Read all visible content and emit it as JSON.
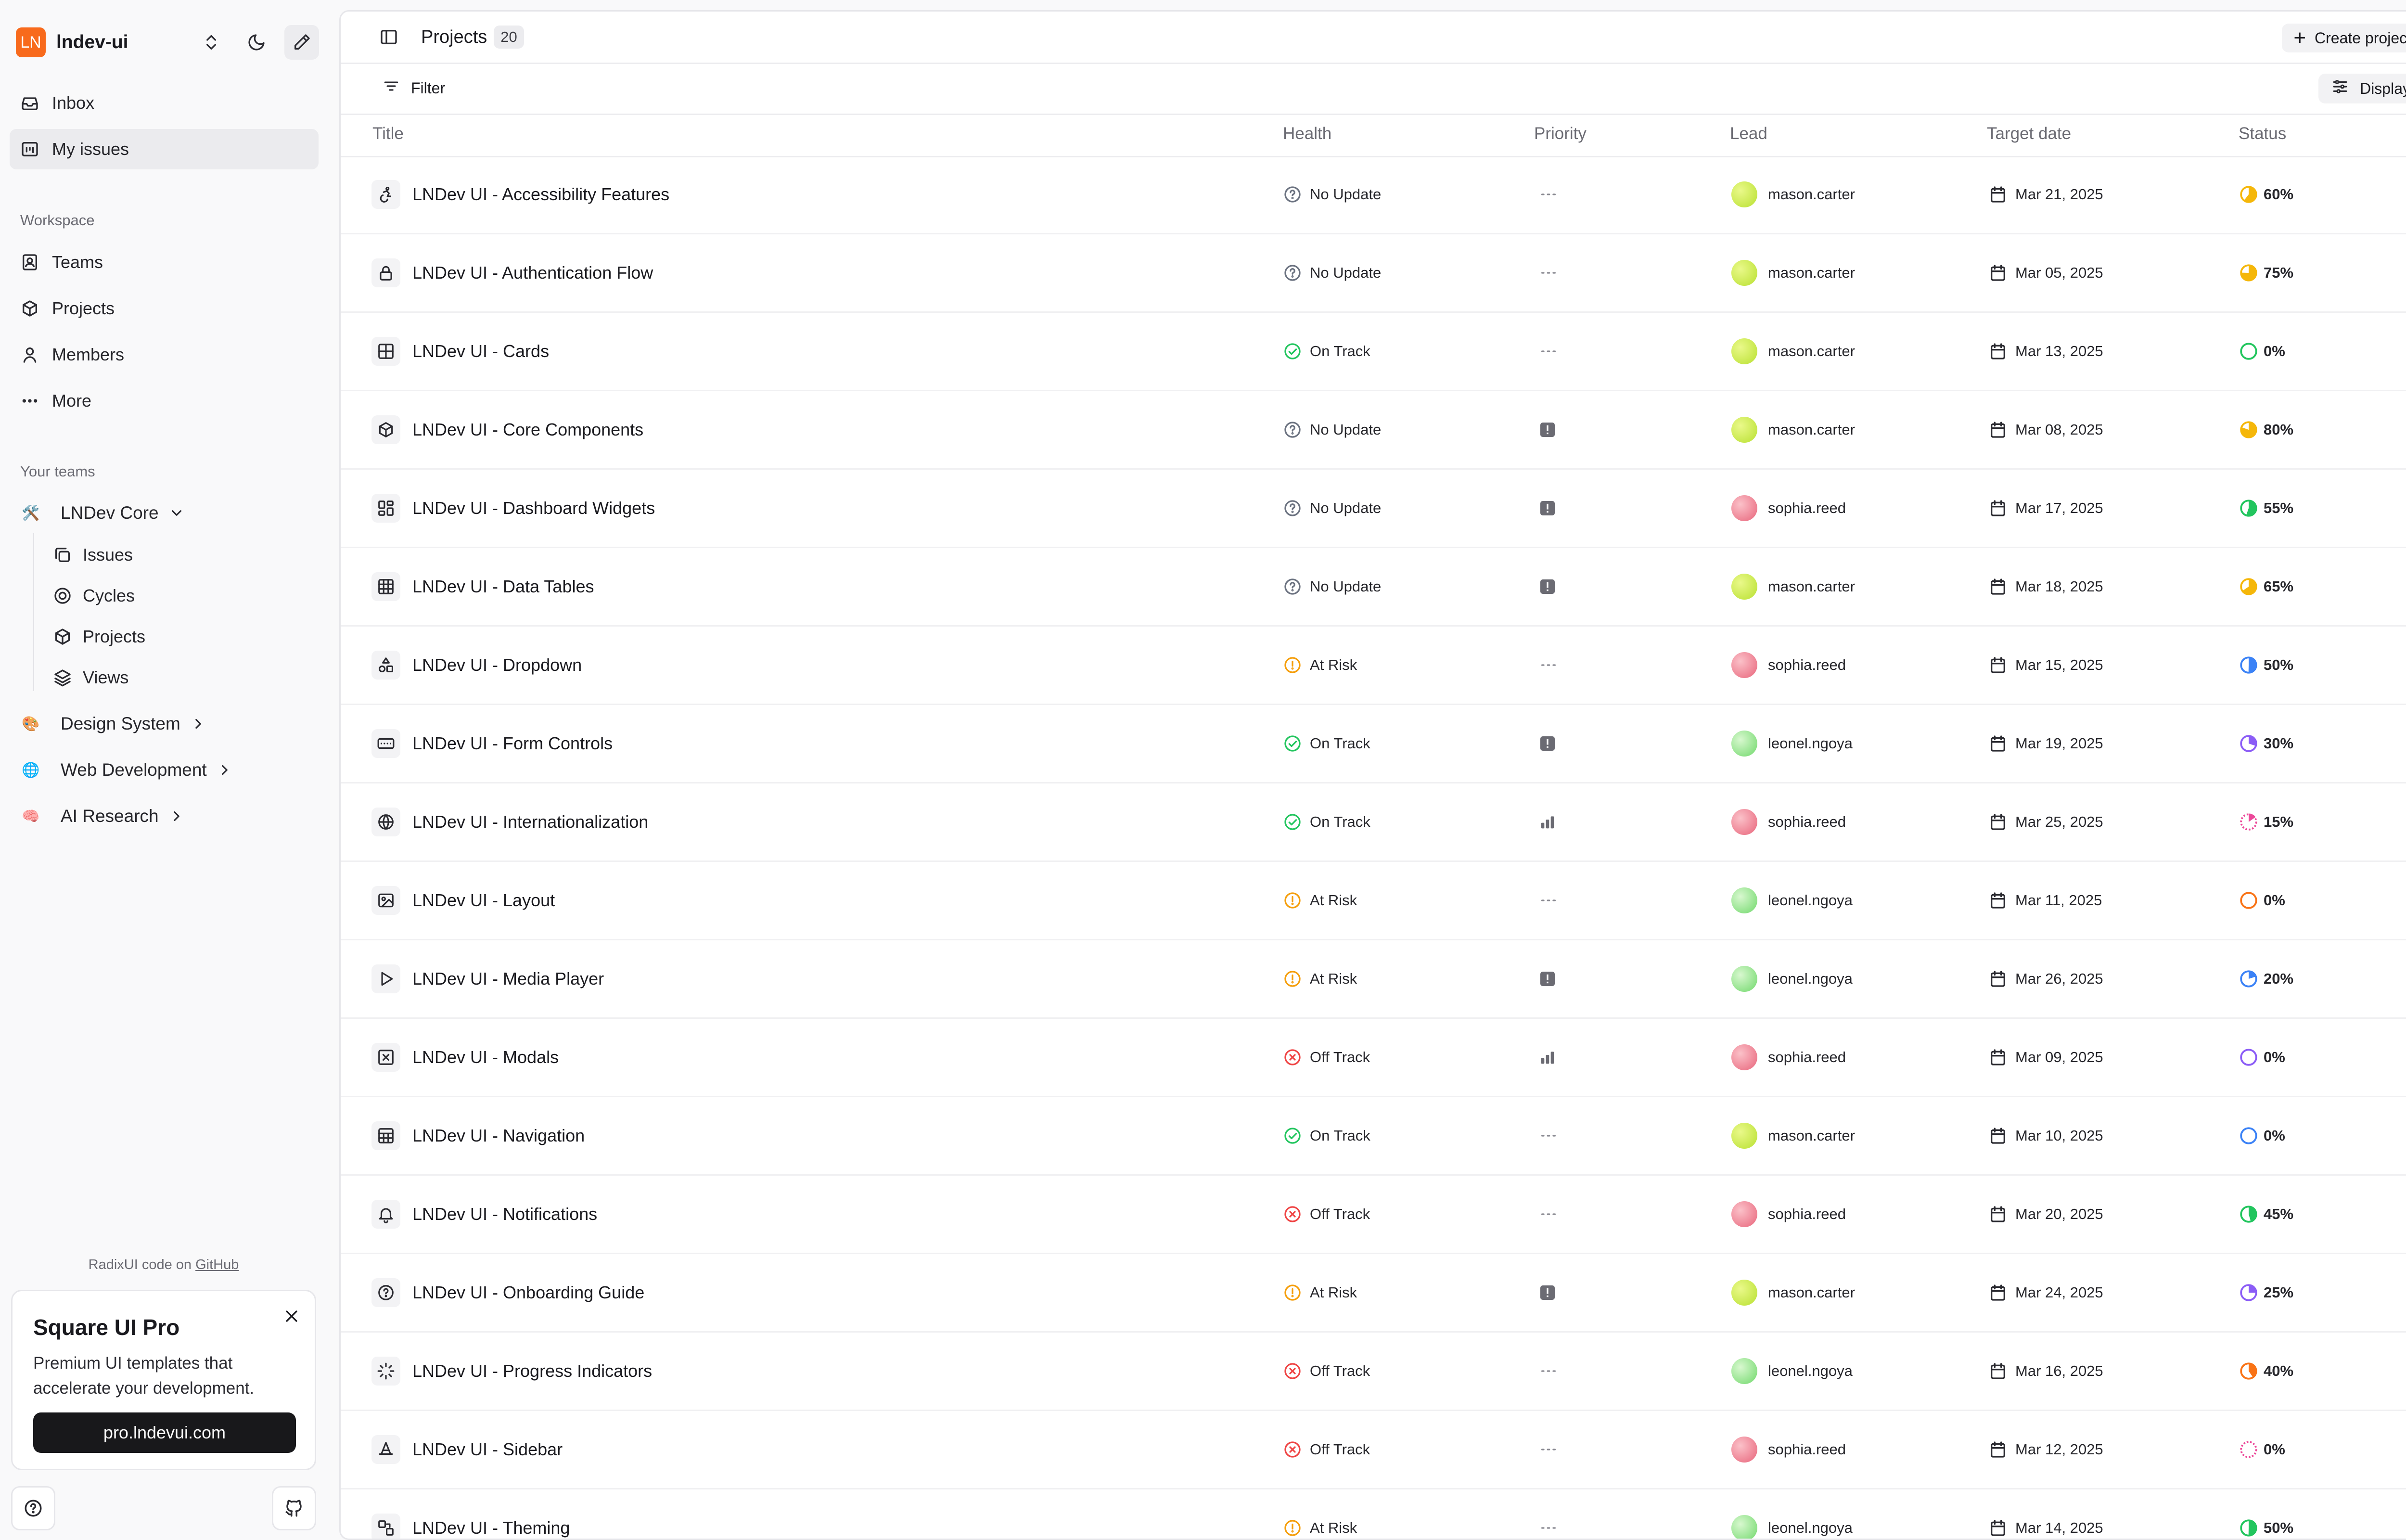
{
  "workspace": {
    "logo_text": "LN",
    "name": "lndev-ui"
  },
  "nav": [
    {
      "label": "Inbox",
      "icon": "inbox-icon",
      "active": false
    },
    {
      "label": "My issues",
      "icon": "issues-icon",
      "active": true
    }
  ],
  "workspace_section": {
    "label": "Workspace",
    "items": [
      {
        "label": "Teams",
        "icon": "contacts-icon"
      },
      {
        "label": "Projects",
        "icon": "box-icon"
      },
      {
        "label": "Members",
        "icon": "user-icon"
      },
      {
        "label": "More",
        "icon": "more-icon"
      }
    ]
  },
  "teams_section": {
    "label": "Your teams",
    "teams": [
      {
        "name": "LNDev Core",
        "emoji": "🛠️",
        "expanded": true
      },
      {
        "name": "Design System",
        "emoji": "🎨",
        "expanded": false
      },
      {
        "name": "Web Development",
        "emoji": "🌐",
        "expanded": false
      },
      {
        "name": "AI Research",
        "emoji": "🧠",
        "expanded": false
      }
    ],
    "core_items": [
      {
        "label": "Issues",
        "icon": "copy-icon"
      },
      {
        "label": "Cycles",
        "icon": "cycles-icon"
      },
      {
        "label": "Projects",
        "icon": "box-icon"
      },
      {
        "label": "Views",
        "icon": "layers-icon"
      }
    ]
  },
  "credit": {
    "prefix": "RadixUI code on ",
    "link": "GitHub"
  },
  "promo": {
    "title": "Square UI Pro",
    "text": "Premium UI templates that accelerate your development.",
    "button": "pro.lndevui.com"
  },
  "header": {
    "title": "Projects",
    "count": "20",
    "create_label": "Create project"
  },
  "toolbar": {
    "filter_label": "Filter",
    "display_label": "Display"
  },
  "columns": {
    "title": "Title",
    "health": "Health",
    "priority": "Priority",
    "lead": "Lead",
    "target_date": "Target date",
    "status": "Status"
  },
  "colors": {
    "accent": "#f86a1c",
    "on_track": "#22c55e",
    "at_risk": "#f59e0b",
    "off_track": "#ef4444",
    "no_update": "#6b7280"
  },
  "projects": [
    {
      "title": "LNDev UI - Accessibility Features",
      "icon": "accessibility-icon",
      "health": "No Update",
      "priority": "none",
      "lead": "mason.carter",
      "date": "Mar 21, 2025",
      "status": "60%",
      "status_color": "#f5b70a"
    },
    {
      "title": "LNDev UI - Authentication Flow",
      "icon": "lock-icon",
      "health": "No Update",
      "priority": "none",
      "lead": "mason.carter",
      "date": "Mar 05, 2025",
      "status": "75%",
      "status_color": "#f5b70a"
    },
    {
      "title": "LNDev UI - Cards",
      "icon": "grid-icon",
      "health": "On Track",
      "priority": "none",
      "lead": "mason.carter",
      "date": "Mar 13, 2025",
      "status": "0%",
      "status_color": "#22c55e"
    },
    {
      "title": "LNDev UI - Core Components",
      "icon": "cube-icon",
      "health": "No Update",
      "priority": "urgent",
      "lead": "mason.carter",
      "date": "Mar 08, 2025",
      "status": "80%",
      "status_color": "#f5b70a"
    },
    {
      "title": "LNDev UI - Dashboard Widgets",
      "icon": "dashboard-icon",
      "health": "No Update",
      "priority": "urgent",
      "lead": "sophia.reed",
      "date": "Mar 17, 2025",
      "status": "55%",
      "status_color": "#22c55e"
    },
    {
      "title": "LNDev UI - Data Tables",
      "icon": "table-icon",
      "health": "No Update",
      "priority": "urgent",
      "lead": "mason.carter",
      "date": "Mar 18, 2025",
      "status": "65%",
      "status_color": "#f5b70a"
    },
    {
      "title": "LNDev UI - Dropdown",
      "icon": "shapes-icon",
      "health": "At Risk",
      "priority": "none",
      "lead": "sophia.reed",
      "date": "Mar 15, 2025",
      "status": "50%",
      "status_color": "#3b82f6"
    },
    {
      "title": "LNDev UI - Form Controls",
      "icon": "input-icon",
      "health": "On Track",
      "priority": "urgent",
      "lead": "leonel.ngoya",
      "date": "Mar 19, 2025",
      "status": "30%",
      "status_color": "#8b5cf6"
    },
    {
      "title": "LNDev UI - Internationalization",
      "icon": "globe-icon",
      "health": "On Track",
      "priority": "high",
      "lead": "sophia.reed",
      "date": "Mar 25, 2025",
      "status": "15%",
      "status_color": "#ec4899"
    },
    {
      "title": "LNDev UI - Layout",
      "icon": "layout-icon",
      "health": "At Risk",
      "priority": "none",
      "lead": "leonel.ngoya",
      "date": "Mar 11, 2025",
      "status": "0%",
      "status_color": "#f97316"
    },
    {
      "title": "LNDev UI - Media Player",
      "icon": "play-icon",
      "health": "At Risk",
      "priority": "urgent",
      "lead": "leonel.ngoya",
      "date": "Mar 26, 2025",
      "status": "20%",
      "status_color": "#3b82f6"
    },
    {
      "title": "LNDev UI - Modals",
      "icon": "modal-icon",
      "health": "Off Track",
      "priority": "high",
      "lead": "sophia.reed",
      "date": "Mar 09, 2025",
      "status": "0%",
      "status_color": "#8b5cf6"
    },
    {
      "title": "LNDev UI - Navigation",
      "icon": "navigation-icon",
      "health": "On Track",
      "priority": "none",
      "lead": "mason.carter",
      "date": "Mar 10, 2025",
      "status": "0%",
      "status_color": "#3b82f6"
    },
    {
      "title": "LNDev UI - Notifications",
      "icon": "bell-icon",
      "health": "Off Track",
      "priority": "none",
      "lead": "sophia.reed",
      "date": "Mar 20, 2025",
      "status": "45%",
      "status_color": "#22c55e"
    },
    {
      "title": "LNDev UI - Onboarding Guide",
      "icon": "help-icon",
      "health": "At Risk",
      "priority": "urgent",
      "lead": "mason.carter",
      "date": "Mar 24, 2025",
      "status": "25%",
      "status_color": "#8b5cf6"
    },
    {
      "title": "LNDev UI - Progress Indicators",
      "icon": "loader-icon",
      "health": "Off Track",
      "priority": "none",
      "lead": "leonel.ngoya",
      "date": "Mar 16, 2025",
      "status": "40%",
      "status_color": "#f97316"
    },
    {
      "title": "LNDev UI - Sidebar",
      "icon": "cone-icon",
      "health": "Off Track",
      "priority": "none",
      "lead": "sophia.reed",
      "date": "Mar 12, 2025",
      "status": "0%",
      "status_color": "#ec4899"
    },
    {
      "title": "LNDev UI - Theming",
      "icon": "palette-icon",
      "health": "At Risk",
      "priority": "none",
      "lead": "leonel.ngoya",
      "date": "Mar 14, 2025",
      "status": "50%",
      "status_color": "#22c55e"
    }
  ]
}
